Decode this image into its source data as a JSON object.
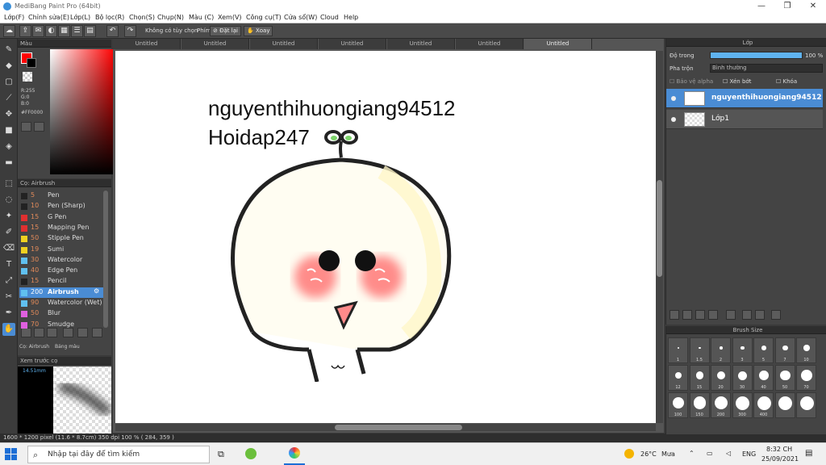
{
  "window": {
    "title": "MediBang Paint Pro (64bit)",
    "controls": [
      "—",
      "❐",
      "✕"
    ]
  },
  "menu": [
    "Lớp(F)",
    "Chỉnh sửa(E)",
    "Lớp(L)",
    "Bộ lọc(R)",
    "Chọn(S)",
    "Chụp(N)",
    "Màu (C)",
    "Xem(V)",
    "Công cụ(T)",
    "Cửa sổ(W)",
    "Cloud",
    "Help"
  ],
  "toolbar": {
    "mode_text": "Không có tùy chọn",
    "shortcut_label": "Phím",
    "flip_label": "Đặt lại",
    "rotate_label": "Xoay"
  },
  "color_panel": {
    "title": "Màu",
    "r": "R:255",
    "g": "G:0",
    "b": "B:0",
    "hex": "#FF0000"
  },
  "brush_panel": {
    "title": "Cọ: Airbrush",
    "brushes": [
      {
        "size": "5",
        "name": "Pen",
        "color": "#222222"
      },
      {
        "size": "10",
        "name": "Pen (Sharp)",
        "color": "#222222"
      },
      {
        "size": "15",
        "name": "G Pen",
        "color": "#e03030"
      },
      {
        "size": "15",
        "name": "Mapping Pen",
        "color": "#e03030"
      },
      {
        "size": "50",
        "name": "Stipple Pen",
        "color": "#f0d020"
      },
      {
        "size": "19",
        "name": "Sumi",
        "color": "#f0d020"
      },
      {
        "size": "30",
        "name": "Watercolor",
        "color": "#60c0f0"
      },
      {
        "size": "40",
        "name": "Edge Pen",
        "color": "#60c0f0"
      },
      {
        "size": "15",
        "name": "Pencil",
        "color": "#222222"
      },
      {
        "size": "200",
        "name": "Airbrush",
        "color": "#60c0f0",
        "active": true
      },
      {
        "size": "90",
        "name": "Watercolor (Wet)",
        "color": "#60c0f0"
      },
      {
        "size": "50",
        "name": "Blur",
        "color": "#e060e0"
      },
      {
        "size": "70",
        "name": "Smudge",
        "color": "#e060e0"
      }
    ],
    "tab_brush": "Cọ: Airbrush",
    "tab_palette": "Bảng màu"
  },
  "preview_panel": {
    "title": "Xem trước cọ",
    "size": "14.51mm"
  },
  "documents": {
    "tabs": [
      "Untitled",
      "Untitled",
      "Untitled",
      "Untitled",
      "Untitled",
      "Untitled",
      "Untitled"
    ],
    "active_index": 6
  },
  "canvas": {
    "text_line1": "nguyenthihuongiang94512",
    "text_line2": "Hoidap247"
  },
  "status": {
    "text": "1600 * 1200 pixel   (11.6 * 8.7cm)   350 dpi   100 %   ( 284, 359 )"
  },
  "layer_panel": {
    "title": "Lớp",
    "opacity_label": "Độ trong",
    "opacity_value": "100 %",
    "opacity": 1.0,
    "blend_label": "Pha trộn",
    "blend_value": "Bình thường",
    "protect_alpha": "Bảo vệ alpha",
    "clipping": "Xén bớt",
    "lock": "Khóa",
    "layers": [
      {
        "name": "nguyenthihuongiang94512",
        "active": true
      },
      {
        "name": "Lớp1",
        "active": false
      }
    ]
  },
  "brush_size_panel": {
    "title": "Brush Size",
    "sizes": [
      "1",
      "1.5",
      "2",
      "3",
      "5",
      "7",
      "10",
      "12",
      "15",
      "20",
      "30",
      "40",
      "50",
      "70",
      "100",
      "150",
      "200",
      "300",
      "400",
      "",
      ""
    ]
  },
  "taskbar": {
    "search_placeholder": "Nhập tại đây để tìm kiếm",
    "weather_temp": "26°C",
    "weather_text": "Mưa",
    "language": "ENG",
    "time": "8:32 CH",
    "date": "25/09/2021"
  }
}
